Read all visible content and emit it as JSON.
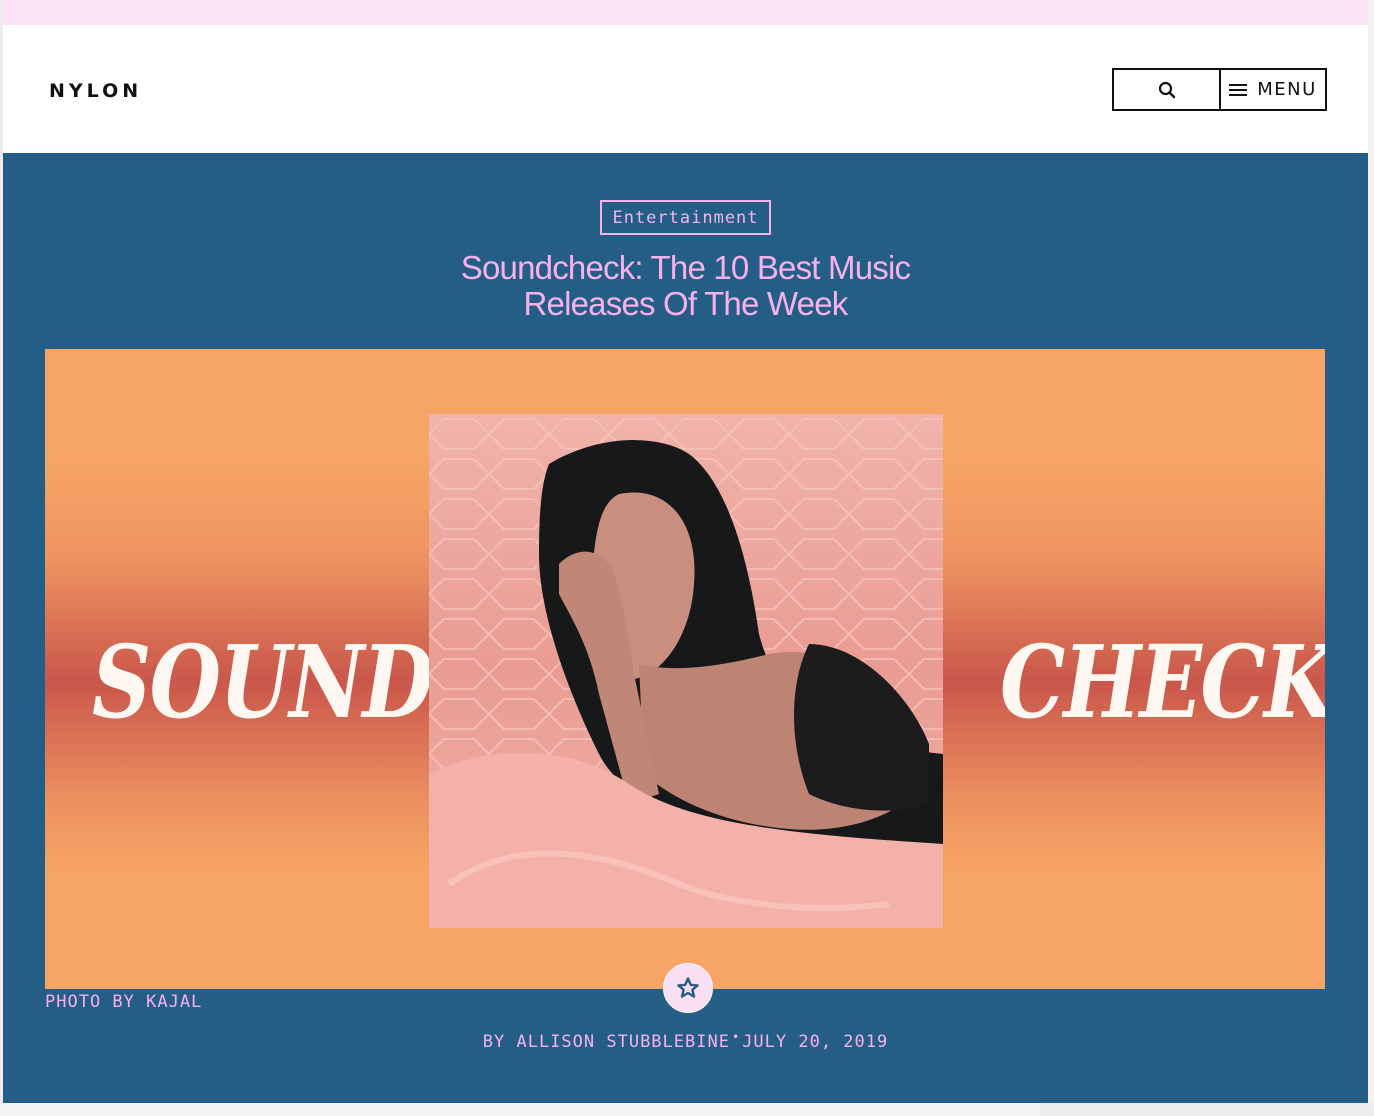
{
  "header": {
    "logo": "NYLON",
    "menu_label": "MENU"
  },
  "icons": {
    "search": "search-icon",
    "menu": "hamburger-menu-icon",
    "badge": "star-icon"
  },
  "article": {
    "category": "Entertainment",
    "title_line1": "Soundcheck: The 10 Best Music",
    "title_line2": "Releases Of The Week",
    "hero_left_word": "SOUND",
    "hero_right_word": "CHECK",
    "photo_credit": "PHOTO BY KAJAL",
    "byline_prefix": "BY",
    "author": "ALLISON STUBBLEBINE",
    "separator": "•",
    "date": "JULY 20, 2019"
  },
  "colors": {
    "top_strip": "#fde3f8",
    "hero_background": "#245e86",
    "accent_pink": "#f7b1ec",
    "art_orange": "#f7a566",
    "art_red": "#c9574b"
  }
}
